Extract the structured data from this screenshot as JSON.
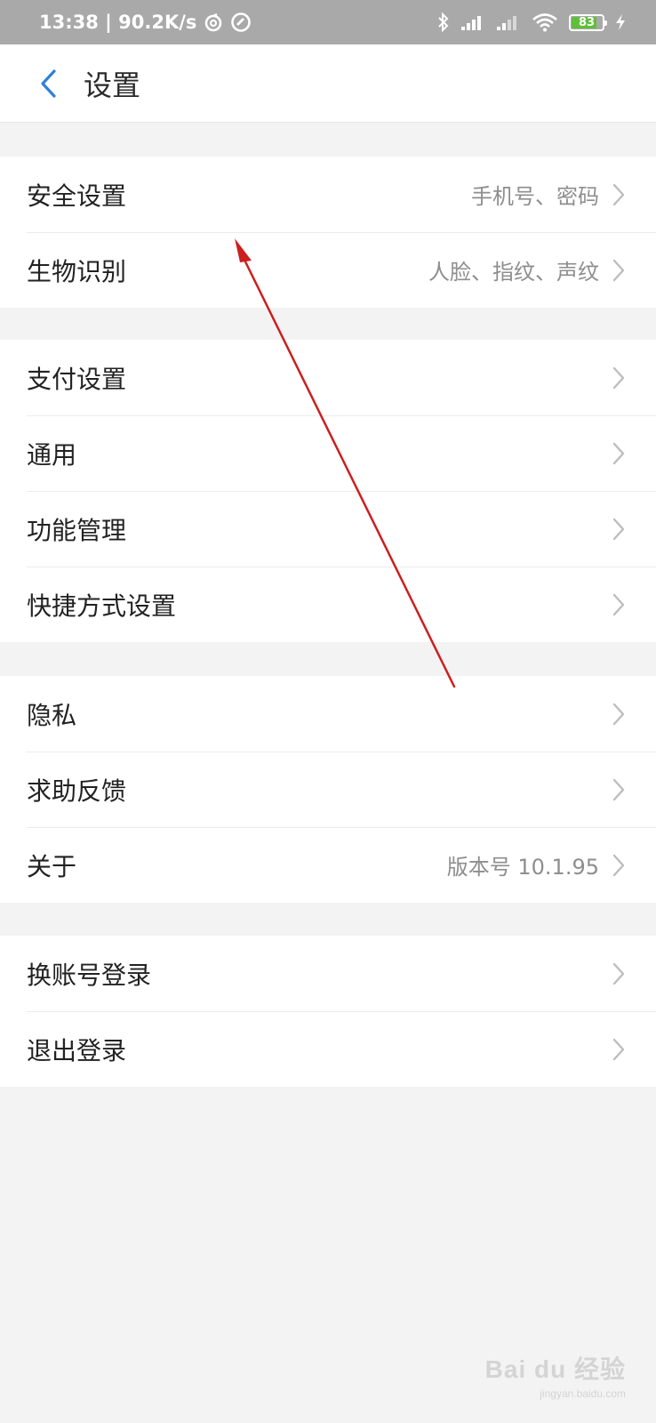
{
  "status_bar": {
    "time_speed": "13:38 | 90.2K/s",
    "battery_level": "83",
    "battery_color": "#5fbf3a",
    "icons": [
      "sync-icon",
      "at-icon",
      "bluetooth-icon",
      "signal-icon",
      "signal-weak-icon",
      "wifi-icon",
      "battery-icon",
      "charging-icon"
    ]
  },
  "header": {
    "title": "设置",
    "back_icon": "chevron-left-icon",
    "accent_color": "#2f7fd8"
  },
  "groups": [
    {
      "items": [
        {
          "label": "安全设置",
          "value": "手机号、密码"
        },
        {
          "label": "生物识别",
          "value": "人脸、指纹、声纹"
        }
      ]
    },
    {
      "items": [
        {
          "label": "支付设置"
        },
        {
          "label": "通用"
        },
        {
          "label": "功能管理"
        },
        {
          "label": "快捷方式设置"
        }
      ]
    },
    {
      "items": [
        {
          "label": "隐私"
        },
        {
          "label": "求助反馈"
        },
        {
          "label": "关于",
          "value": "版本号 10.1.95"
        }
      ]
    },
    {
      "items": [
        {
          "label": "换账号登录"
        },
        {
          "label": "退出登录"
        }
      ]
    }
  ],
  "annotation": {
    "arrow_color": "#cc1f1f"
  },
  "watermark": {
    "main": "Bai du 经验",
    "sub": "jingyan.baidu.com"
  }
}
